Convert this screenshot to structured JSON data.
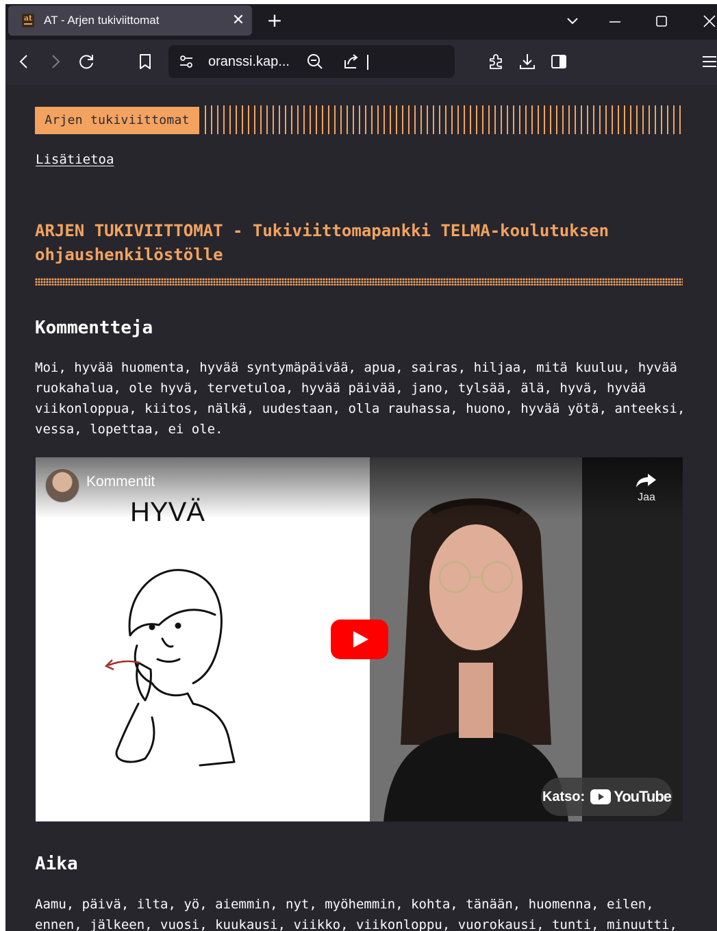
{
  "browser": {
    "tab": {
      "favicon_text": "at",
      "title": "AT - Arjen tukiviittomat",
      "close_glyph": "✕"
    },
    "new_tab_glyph": "+",
    "url": "oranssi.kap...",
    "icons": {
      "back": "back-arrow-icon",
      "forward": "forward-arrow-icon",
      "reload": "reload-icon",
      "bookmark": "bookmark-icon",
      "site_info": "permissions-icon",
      "zoom": "zoom-out-icon",
      "share": "share-icon",
      "extensions": "extensions-icon",
      "downloads": "download-icon",
      "sidebar": "sidebar-icon",
      "menu": "hamburger-menu-icon"
    }
  },
  "page": {
    "brand": "Arjen tukiviittomat",
    "more_link": "Lisätietoa",
    "heading": "ARJEN TUKIVIITTOMAT - Tukiviittomapankki TELMA-koulutuksen ohjaushenkilöstölle",
    "sections": [
      {
        "title": "Kommentteja",
        "text": "Moi, hyvää huomenta, hyvää syntymäpäivää, apua, sairas, hiljaa, mitä kuuluu, hyvää ruokahalua, ole hyvä, tervetuloa, hyvää päivää, jano, tylsää, älä, hyvä, hyvää viikonloppua, kiitos, nälkä, uudestaan, olla rauhassa, huono, hyvää yötä, anteeksi, vessa, lopettaa, ei ole."
      },
      {
        "title": "Aika",
        "text": "Aamu, päivä, ilta, yö, aiemmin, nyt, myöhemmin, kohta, tänään, huomenna, eilen, ennen, jälkeen, vuosi, kuukausi, viikko, viikonloppu, vuorokausi, tunti, minuutti,"
      }
    ],
    "video": {
      "title": "Kommentit",
      "sign_word": "HYVÄ",
      "share_label": "Jaa",
      "watch_on_label": "Katso:",
      "youtube_label": "YouTube"
    }
  },
  "colors": {
    "accent": "#f3a35f",
    "page_bg": "#27262d",
    "browser_chrome": "#2b2a33",
    "youtube_red": "#ff0000"
  }
}
